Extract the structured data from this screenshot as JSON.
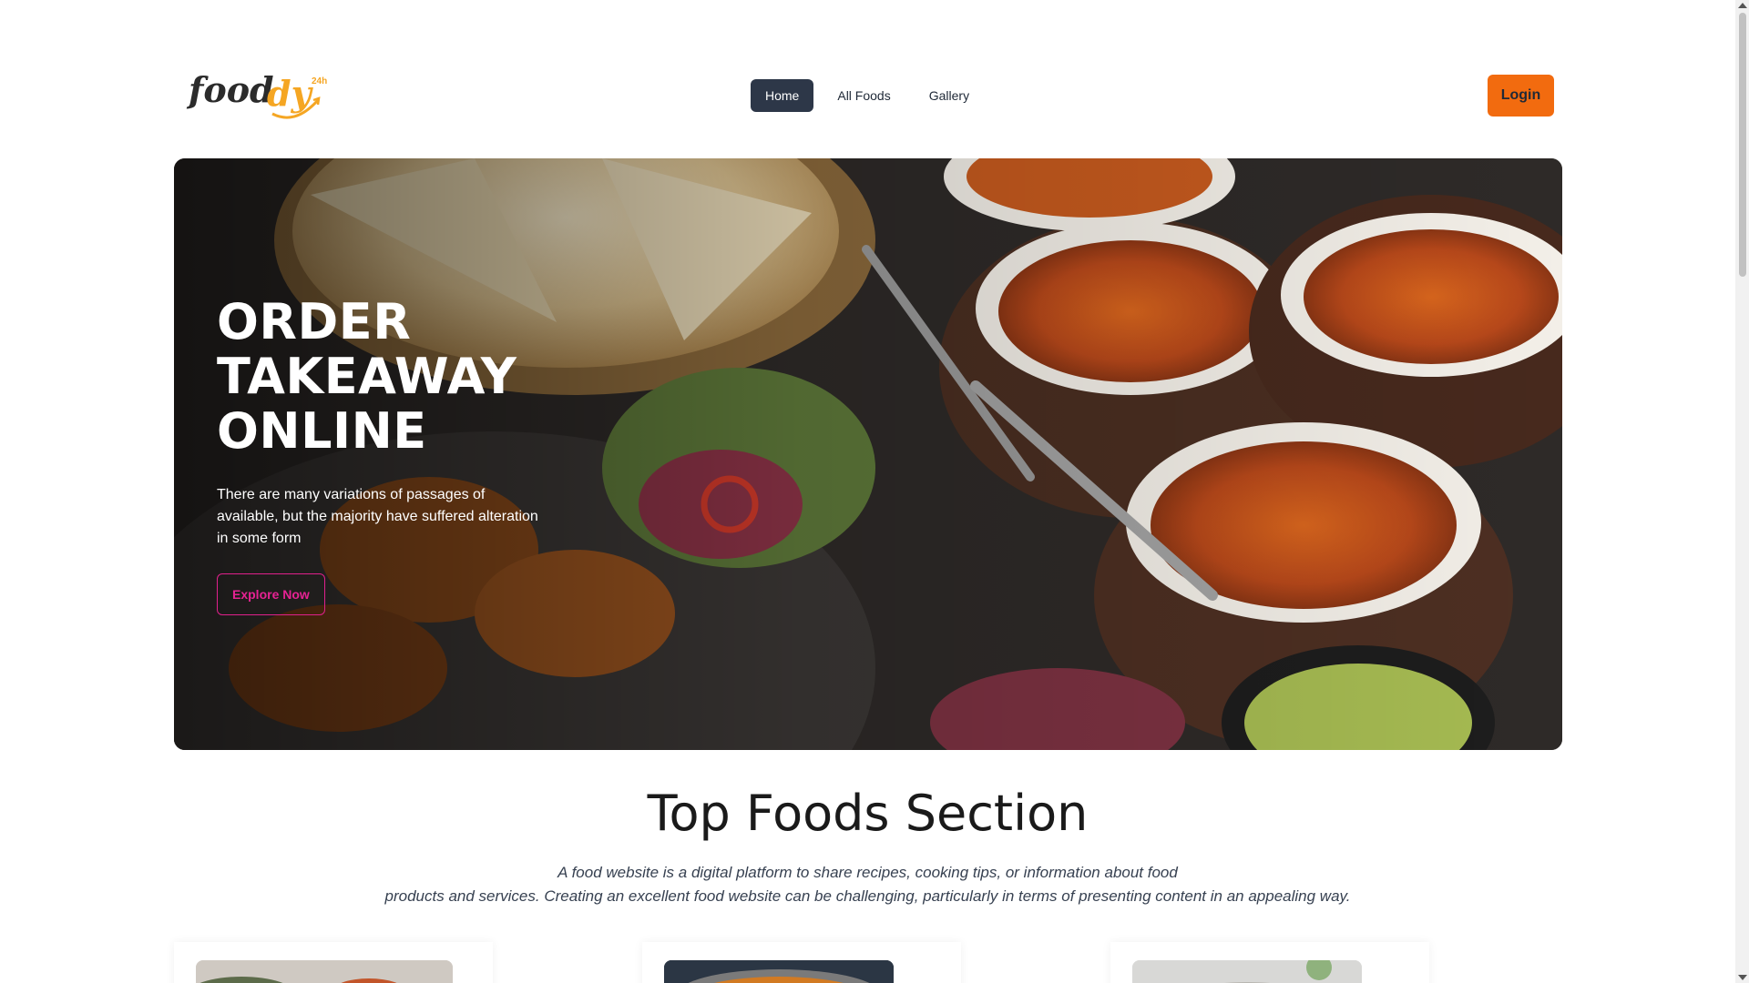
{
  "header": {
    "logo_text": "Fooddy",
    "logo_badge": "24h",
    "nav": [
      {
        "label": "Home",
        "active": true
      },
      {
        "label": "All Foods",
        "active": false
      },
      {
        "label": "Gallery",
        "active": false
      }
    ],
    "login_label": "Login"
  },
  "hero": {
    "title_lines": [
      "ORDER",
      "TAKEAWAY",
      "ONLINE"
    ],
    "description": "There are many variations of passages of available, but the majority have suffered alteration in some form",
    "cta_label": "Explore Now"
  },
  "section": {
    "title": "Top Foods Section",
    "description_line1": "A food website is a digital platform to share recipes, cooking tips, or information about food",
    "description_line2": "products and services. Creating an excellent food website can be challenging, particularly in terms of presenting content in an appealing way."
  },
  "colors": {
    "accent": "#f26b0f",
    "nav_active": "#2d3748",
    "cta": "#e62293",
    "logo_orange": "#f5a623"
  }
}
